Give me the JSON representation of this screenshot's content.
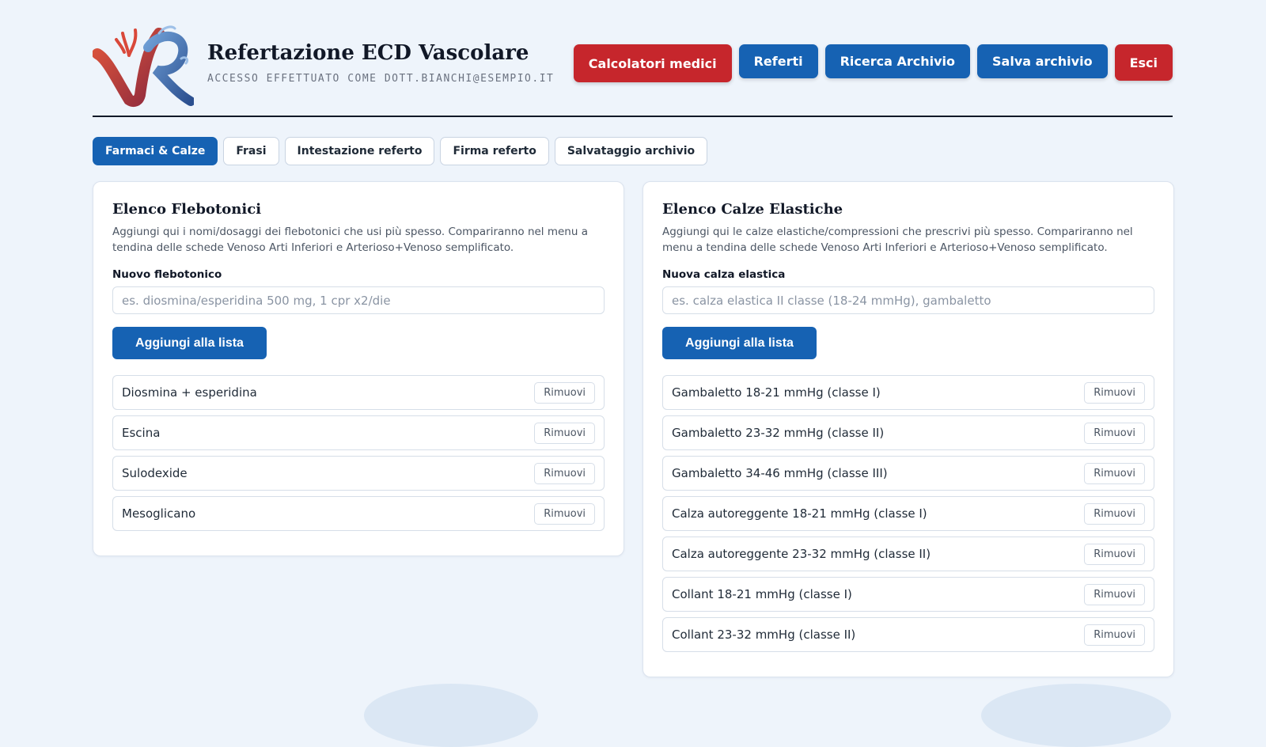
{
  "header": {
    "title": "Refertazione ECD Vascolare",
    "subtitle": "ACCESSO EFFETTUATO COME DOTT.BIANCHI@ESEMPIO.IT",
    "buttons": {
      "calcolatori": "Calcolatori medici",
      "referti": "Referti",
      "ricerca": "Ricerca Archivio",
      "salva": "Salva archivio",
      "esci": "Esci"
    }
  },
  "tabs": [
    "Farmaci & Calze",
    "Frasi",
    "Intestazione referto",
    "Firma referto",
    "Salvataggio archivio"
  ],
  "flebotonici": {
    "title": "Elenco Flebotonici",
    "description": "Aggiungi qui i nomi/dosaggi dei flebotonici che usi più spesso. Compariranno nel menu a tendina delle schede Venoso Arti Inferiori e Arterioso+Venoso semplificato.",
    "field_label": "Nuovo flebotonico",
    "placeholder": "es. diosmina/esperidina 500 mg, 1 cpr x2/die",
    "add_label": "Aggiungi alla lista",
    "remove_label": "Rimuovi",
    "items": [
      "Diosmina + esperidina",
      "Escina",
      "Sulodexide",
      "Mesoglicano"
    ]
  },
  "calze": {
    "title": "Elenco Calze Elastiche",
    "description": "Aggiungi qui le calze elastiche/compressioni che prescrivi più spesso. Compariranno nel menu a tendina delle schede Venoso Arti Inferiori e Arterioso+Venoso semplificato.",
    "field_label": "Nuova calza elastica",
    "placeholder": "es. calza elastica II classe (18-24 mmHg), gambaletto",
    "add_label": "Aggiungi alla lista",
    "remove_label": "Rimuovi",
    "items": [
      "Gambaletto 18-21 mmHg (classe I)",
      "Gambaletto 23-32 mmHg (classe II)",
      "Gambaletto 34-46 mmHg (classe III)",
      "Calza autoreggente 18-21 mmHg (classe I)",
      "Calza autoreggente 23-32 mmHg (classe II)",
      "Collant 18-21 mmHg (classe I)",
      "Collant 23-32 mmHg (classe II)"
    ]
  }
}
